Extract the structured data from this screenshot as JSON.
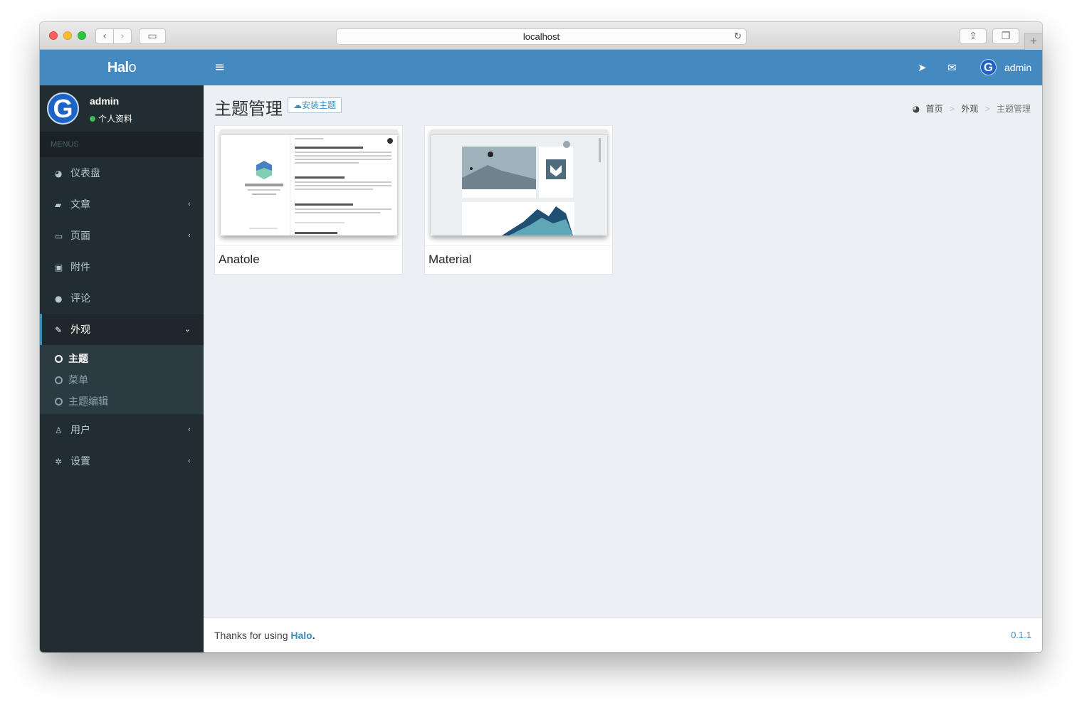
{
  "browser": {
    "url": "localhost"
  },
  "brand": {
    "part_bold": "Hal",
    "part_light": "o"
  },
  "user": {
    "name": "admin",
    "avatar_letter": "G",
    "profile_link": "个人资料"
  },
  "menu_header": "MENUS",
  "menu": [
    {
      "label": "仪表盘",
      "icon": "dashboard-icon"
    },
    {
      "label": "文章",
      "icon": "book-icon",
      "expandable": true
    },
    {
      "label": "页面",
      "icon": "desktop-icon",
      "expandable": true
    },
    {
      "label": "附件",
      "icon": "image-icon"
    },
    {
      "label": "评论",
      "icon": "comment-icon"
    },
    {
      "label": "外观",
      "icon": "paint-brush-icon",
      "expanded": true,
      "active": true
    },
    {
      "label": "用户",
      "icon": "user-icon",
      "expandable": true
    },
    {
      "label": "设置",
      "icon": "cog-icon",
      "expandable": true
    }
  ],
  "submenu": [
    {
      "label": "主题",
      "active": true
    },
    {
      "label": "菜单"
    },
    {
      "label": "主题编辑"
    }
  ],
  "topbar": {
    "username": "admin"
  },
  "page": {
    "title": "主题管理",
    "install_button": "安装主题",
    "breadcrumb": [
      "首页",
      "外观",
      "主题管理"
    ]
  },
  "themes": [
    {
      "name": "Anatole"
    },
    {
      "name": "Material"
    }
  ],
  "footer": {
    "text_before": "Thanks for using ",
    "link": "Halo",
    "text_after": ".",
    "version": "0.1.1"
  },
  "colors": {
    "header_blue": "#4589c1",
    "sidebar_dark": "#222d32",
    "accent": "#3c8dbc",
    "content_bg": "#ecf0f5"
  }
}
